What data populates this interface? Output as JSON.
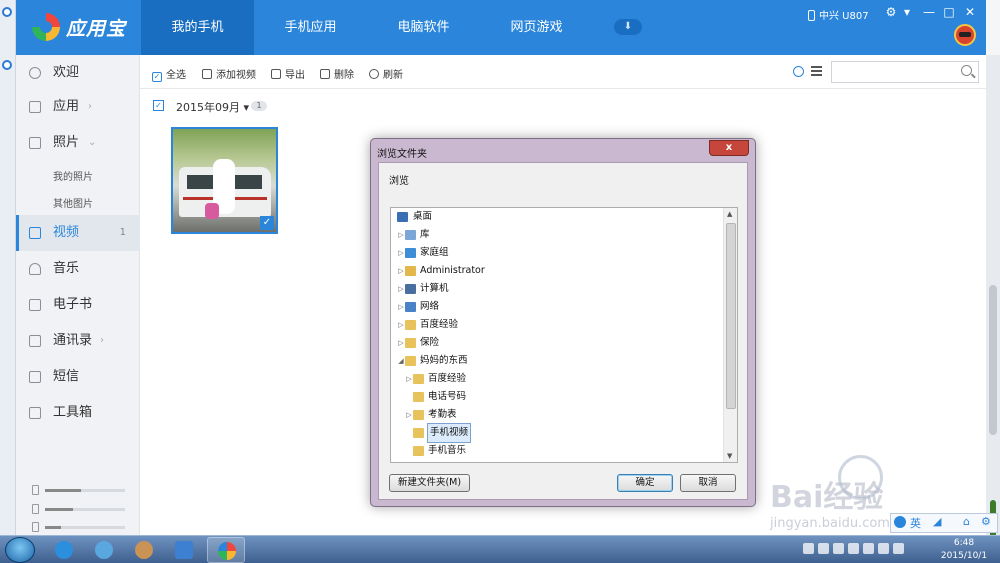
{
  "app": {
    "brand": "应用宝",
    "tabs": [
      "我的手机",
      "手机应用",
      "电脑软件",
      "网页游戏"
    ],
    "active_tab": 0,
    "device": "中兴 U807",
    "accent": "#2b86db"
  },
  "sidebar": {
    "items": [
      {
        "label": "欢迎",
        "icon": "welcome-icon"
      },
      {
        "label": "应用",
        "icon": "grid-icon",
        "chevron": "›"
      },
      {
        "label": "照片",
        "icon": "photo-icon",
        "chevron": "⌄"
      },
      {
        "label": "视频",
        "icon": "video-icon",
        "count": "1"
      },
      {
        "label": "音乐",
        "icon": "music-icon"
      },
      {
        "label": "电子书",
        "icon": "book-icon"
      },
      {
        "label": "通讯录",
        "icon": "contacts-icon",
        "chevron": "›"
      },
      {
        "label": "短信",
        "icon": "sms-icon"
      },
      {
        "label": "工具箱",
        "icon": "toolbox-icon"
      }
    ],
    "photo_subitems": [
      "我的照片",
      "其他图片"
    ],
    "storage_levels": [
      0.45,
      0.35,
      0.2
    ]
  },
  "toolbar": {
    "select_all": "全选",
    "add_video": "添加视频",
    "export": "导出",
    "delete": "删除",
    "refresh": "刷新",
    "search_placeholder": ""
  },
  "content": {
    "group_date": "2015年09月",
    "group_count": "1"
  },
  "dialog": {
    "title": "浏览文件夹",
    "close": "x",
    "prompt": "浏览",
    "tree": [
      {
        "label": "桌面",
        "level": 0,
        "arrow": "",
        "icon": "desktop-icon"
      },
      {
        "label": "库",
        "level": 1,
        "arrow": "▷",
        "icon": "library-icon"
      },
      {
        "label": "家庭组",
        "level": 1,
        "arrow": "▷",
        "icon": "homegroup-icon"
      },
      {
        "label": "Administrator",
        "level": 1,
        "arrow": "▷",
        "icon": "user-folder-icon"
      },
      {
        "label": "计算机",
        "level": 1,
        "arrow": "▷",
        "icon": "computer-icon"
      },
      {
        "label": "网络",
        "level": 1,
        "arrow": "▷",
        "icon": "network-icon"
      },
      {
        "label": "百度经验",
        "level": 1,
        "arrow": "▷",
        "icon": "folder-icon"
      },
      {
        "label": "保险",
        "level": 1,
        "arrow": "▷",
        "icon": "folder-icon"
      },
      {
        "label": "妈妈的东西",
        "level": 1,
        "arrow": "◢",
        "icon": "folder-icon"
      },
      {
        "label": "百度经验",
        "level": 2,
        "arrow": "▷",
        "icon": "folder-icon"
      },
      {
        "label": "电话号码",
        "level": 2,
        "arrow": "",
        "icon": "folder-icon"
      },
      {
        "label": "考勤表",
        "level": 2,
        "arrow": "▷",
        "icon": "folder-icon"
      },
      {
        "label": "手机视频",
        "level": 2,
        "arrow": "",
        "icon": "folder-icon",
        "selected": true
      },
      {
        "label": "手机音乐",
        "level": 2,
        "arrow": "",
        "icon": "folder-icon"
      }
    ],
    "new_folder": "新建文件夹(M)",
    "ok": "确定",
    "cancel": "取消"
  },
  "watermark": {
    "text": "Bai经验",
    "url": "jingyan.baidu.com"
  },
  "ime": {
    "label": "英"
  },
  "taskbar": {
    "time": "6:48",
    "date": "2015/10/1"
  }
}
